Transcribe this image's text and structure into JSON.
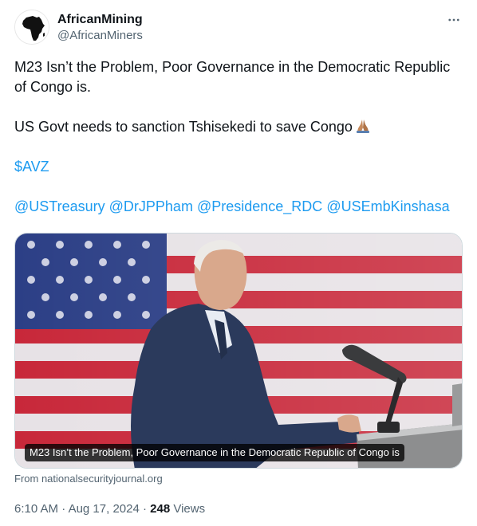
{
  "author": {
    "display_name": "AfricanMining",
    "handle": "@AfricanMiners",
    "avatar_icon": "africa-silhouette-icon"
  },
  "more_icon": "more-dots-icon",
  "tweet": {
    "line1": "M23 Isn’t the Problem, Poor Governance in the Democratic Republic of Congo is.",
    "line2": "US Govt needs to sanction Tshisekedi to save Congo",
    "line2_emoji": "folded-hands-emoji",
    "cashtag": "$AVZ",
    "mentions": [
      "@USTreasury",
      "@DrJPPham",
      "@Presidence_RDC",
      "@USEmbKinshasa"
    ]
  },
  "media": {
    "caption": "M23 Isn’t the Problem, Poor Governance in the Democratic Republic of Congo is",
    "source": "From nationalsecurityjournal.org"
  },
  "meta": {
    "time": "6:10 AM",
    "separator": " · ",
    "date": "Aug 17, 2024",
    "views_count": "248",
    "views_label": "Views"
  },
  "colors": {
    "link": "#1d9bf0",
    "secondary_text": "#536471",
    "primary_text": "#0f1419"
  }
}
